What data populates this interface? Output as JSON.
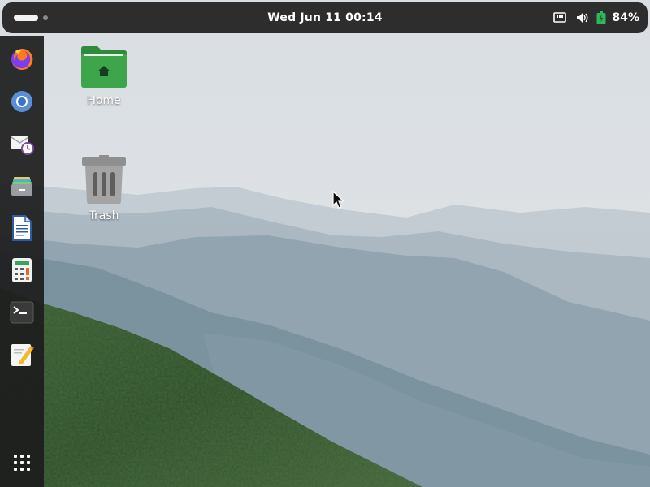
{
  "topbar": {
    "clock": "Wed Jun 11  00:14",
    "battery_percent": "84%",
    "tray_icons": [
      "network-wired-icon",
      "volume-icon",
      "battery-icon"
    ]
  },
  "dock": {
    "apps": [
      {
        "name": "Firefox",
        "icon": "firefox-icon"
      },
      {
        "name": "Chromium",
        "icon": "chromium-icon"
      },
      {
        "name": "Mail",
        "icon": "mail-clock-icon"
      },
      {
        "name": "Files",
        "icon": "file-cabinet-icon"
      },
      {
        "name": "Text Document",
        "icon": "document-icon"
      },
      {
        "name": "Calculator",
        "icon": "calculator-icon"
      },
      {
        "name": "Terminal",
        "icon": "terminal-icon"
      },
      {
        "name": "Text Editor",
        "icon": "text-editor-icon"
      }
    ],
    "show_apps_icon": "app-grid-icon"
  },
  "desktop": {
    "icons": [
      {
        "label": "Home",
        "icon": "home-folder-icon"
      },
      {
        "label": "Trash",
        "icon": "trash-icon"
      }
    ]
  },
  "colors": {
    "topbar_bg": "#2d2d2d",
    "dock_bg": "#1c1c1c",
    "folder_green": "#3ea64a",
    "battery_green": "#2fb55a"
  }
}
